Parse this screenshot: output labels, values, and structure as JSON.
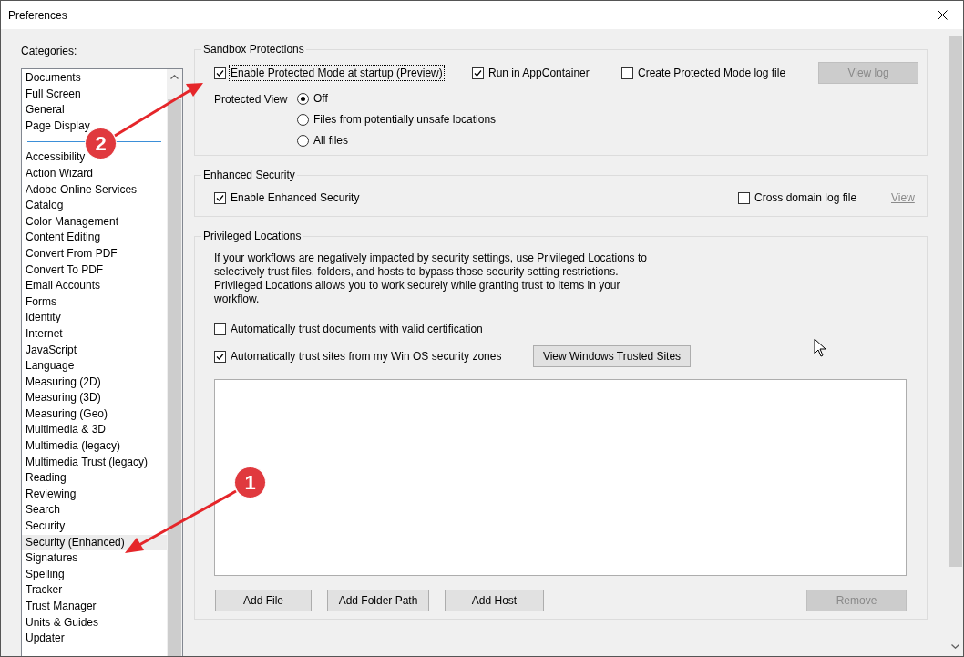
{
  "window": {
    "title": "Preferences"
  },
  "categories": {
    "label": "Categories:",
    "groups": [
      [
        {
          "label": "Documents",
          "selected": false
        },
        {
          "label": "Full Screen",
          "selected": false
        },
        {
          "label": "General",
          "selected": false
        },
        {
          "label": "Page Display",
          "selected": false
        }
      ],
      [
        {
          "label": "Accessibility",
          "selected": false
        },
        {
          "label": "Action Wizard",
          "selected": false
        },
        {
          "label": "Adobe Online Services",
          "selected": false
        },
        {
          "label": "Catalog",
          "selected": false
        },
        {
          "label": "Color Management",
          "selected": false
        },
        {
          "label": "Content Editing",
          "selected": false
        },
        {
          "label": "Convert From PDF",
          "selected": false
        },
        {
          "label": "Convert To PDF",
          "selected": false
        },
        {
          "label": "Email Accounts",
          "selected": false
        },
        {
          "label": "Forms",
          "selected": false
        },
        {
          "label": "Identity",
          "selected": false
        },
        {
          "label": "Internet",
          "selected": false
        },
        {
          "label": "JavaScript",
          "selected": false
        },
        {
          "label": "Language",
          "selected": false
        },
        {
          "label": "Measuring (2D)",
          "selected": false
        },
        {
          "label": "Measuring (3D)",
          "selected": false
        },
        {
          "label": "Measuring (Geo)",
          "selected": false
        },
        {
          "label": "Multimedia & 3D",
          "selected": false
        },
        {
          "label": "Multimedia (legacy)",
          "selected": false
        },
        {
          "label": "Multimedia Trust (legacy)",
          "selected": false
        },
        {
          "label": "Reading",
          "selected": false
        },
        {
          "label": "Reviewing",
          "selected": false
        },
        {
          "label": "Search",
          "selected": false
        },
        {
          "label": "Security",
          "selected": false
        },
        {
          "label": "Security (Enhanced)",
          "selected": true
        },
        {
          "label": "Signatures",
          "selected": false
        },
        {
          "label": "Spelling",
          "selected": false
        },
        {
          "label": "Tracker",
          "selected": false
        },
        {
          "label": "Trust Manager",
          "selected": false
        },
        {
          "label": "Units & Guides",
          "selected": false
        },
        {
          "label": "Updater",
          "selected": false
        }
      ]
    ]
  },
  "sandbox": {
    "title": "Sandbox Protections",
    "checkboxes": [
      {
        "label": "Enable Protected Mode at startup (Preview)",
        "checked": true,
        "focused": true
      },
      {
        "label": "Run in AppContainer",
        "checked": true,
        "focused": false
      },
      {
        "label": "Create Protected Mode log file",
        "checked": false,
        "focused": false
      }
    ],
    "view_log": {
      "label": "View log",
      "disabled": true
    },
    "protected_view": {
      "label": "Protected View",
      "options": [
        {
          "label": "Off",
          "selected": true
        },
        {
          "label": "Files from potentially unsafe locations",
          "selected": false
        },
        {
          "label": "All files",
          "selected": false
        }
      ]
    }
  },
  "enhanced": {
    "title": "Enhanced Security",
    "checkboxes": [
      {
        "label": "Enable Enhanced Security",
        "checked": true
      },
      {
        "label": "Cross domain log file",
        "checked": false
      }
    ],
    "view_link": {
      "label": "View",
      "disabled": true
    }
  },
  "privileged": {
    "title": "Privileged Locations",
    "description": "If your workflows are negatively impacted by security settings, use Privileged Locations to selectively trust files, folders, and hosts to bypass those security setting restrictions. Privileged Locations allows you to work securely while granting trust to items in your workflow.",
    "checkboxes": [
      {
        "label": "Automatically trust documents with valid certification",
        "checked": false
      },
      {
        "label": "Automatically trust sites from my Win OS security zones",
        "checked": true
      }
    ],
    "trusted_sites_button": {
      "label": "View Windows Trusted Sites",
      "disabled": false
    },
    "buttons": [
      {
        "label": "Add File",
        "disabled": false
      },
      {
        "label": "Add Folder Path",
        "disabled": false
      },
      {
        "label": "Add Host",
        "disabled": false
      },
      {
        "label": "Remove",
        "disabled": true
      }
    ]
  },
  "annotations": [
    {
      "number": "1"
    },
    {
      "number": "2"
    }
  ]
}
